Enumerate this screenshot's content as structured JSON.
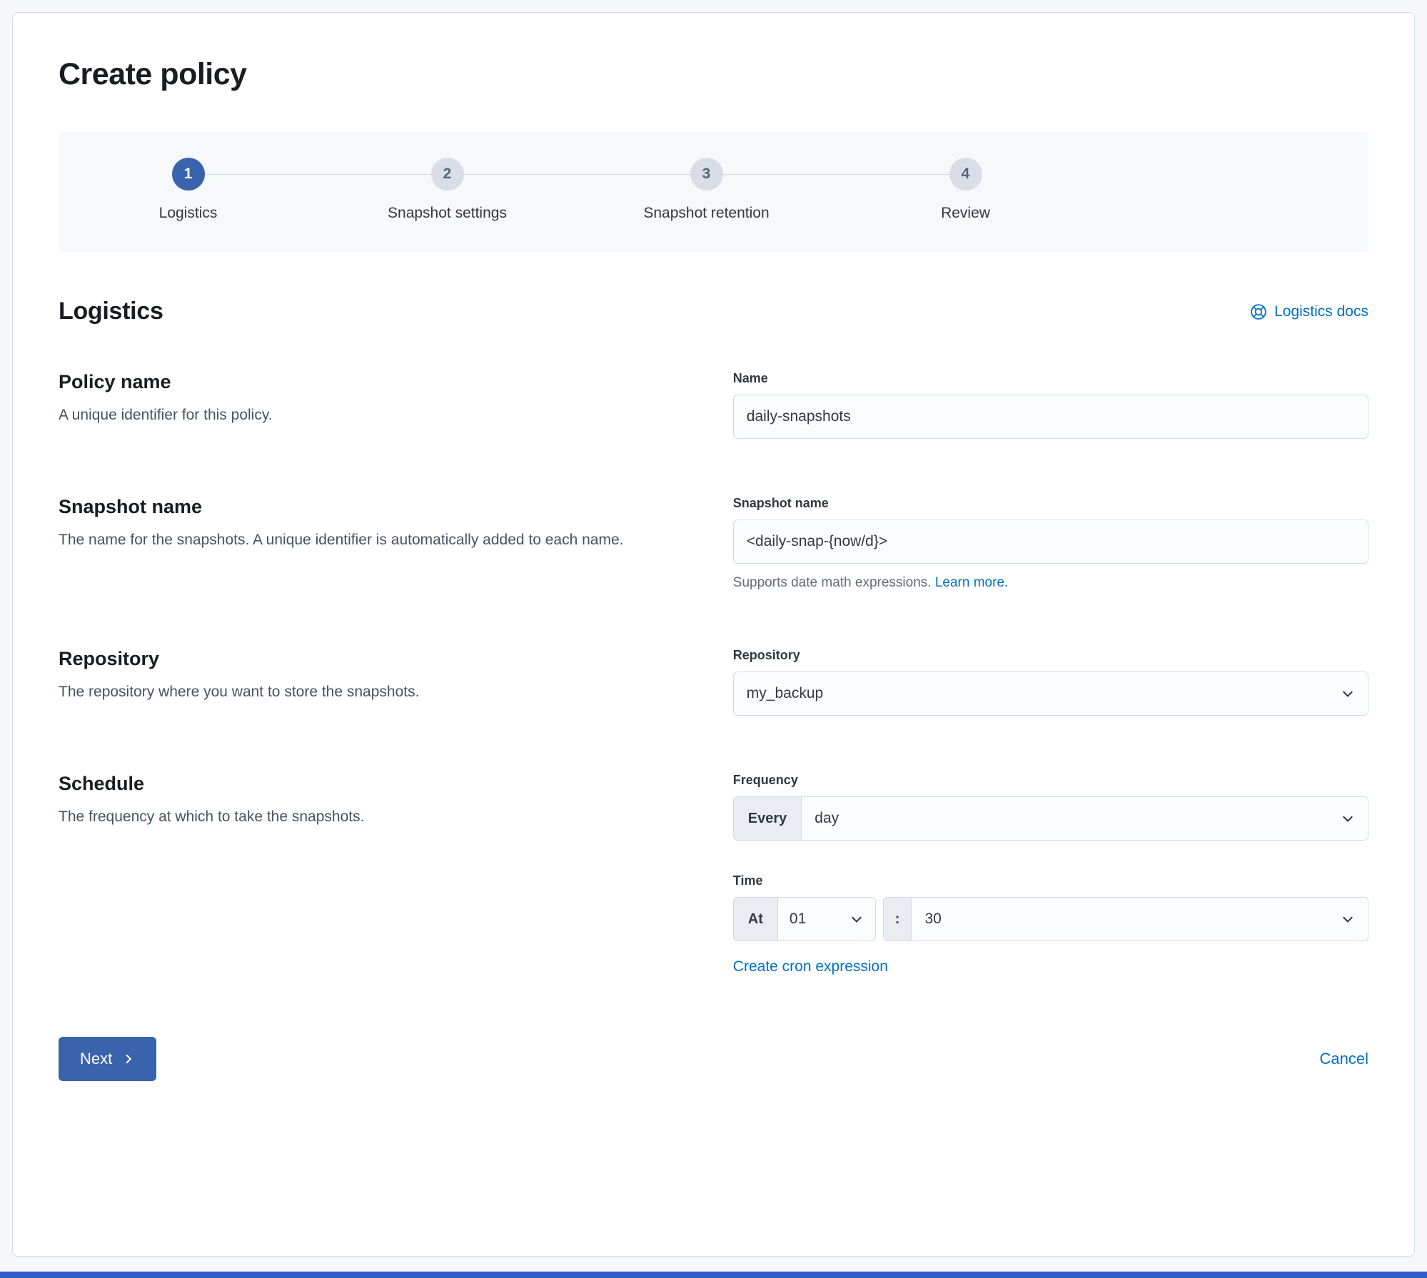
{
  "colors": {
    "primary": "#3a63ad",
    "link": "#0071c2",
    "step_inactive": "#d9dde7",
    "panel_border": "#d3dae6",
    "page_background": "#f5f7fa",
    "bottom_bar": "#2f5bc6"
  },
  "page": {
    "title": "Create policy"
  },
  "stepper": {
    "steps": [
      {
        "number": "1",
        "label": "Logistics",
        "state": "active"
      },
      {
        "number": "2",
        "label": "Snapshot settings",
        "state": "incomplete"
      },
      {
        "number": "3",
        "label": "Snapshot retention",
        "state": "incomplete"
      },
      {
        "number": "4",
        "label": "Review",
        "state": "incomplete"
      }
    ]
  },
  "section": {
    "title": "Logistics",
    "docs_link_label": "Logistics docs"
  },
  "form": {
    "policy_name": {
      "heading": "Policy name",
      "description": "A unique identifier for this policy.",
      "label": "Name",
      "value": "daily-snapshots"
    },
    "snapshot_name": {
      "heading": "Snapshot name",
      "description": "The name for the snapshots. A unique identifier is automatically added to each name.",
      "label": "Snapshot name",
      "value": "<daily-snap-{now/d}>",
      "help_text": "Supports date math expressions.",
      "help_link_label": "Learn more."
    },
    "repository": {
      "heading": "Repository",
      "description": "The repository where you want to store the snapshots.",
      "label": "Repository",
      "value": "my_backup"
    },
    "schedule": {
      "heading": "Schedule",
      "description": "The frequency at which to take the snapshots.",
      "frequency_label": "Frequency",
      "frequency_prepend": "Every",
      "frequency_value": "day",
      "time_label": "Time",
      "time_prepend": "At",
      "hour_value": "01",
      "time_separator": ":",
      "minute_value": "30",
      "cron_link_label": "Create cron expression"
    }
  },
  "footer": {
    "next_label": "Next",
    "cancel_label": "Cancel"
  }
}
